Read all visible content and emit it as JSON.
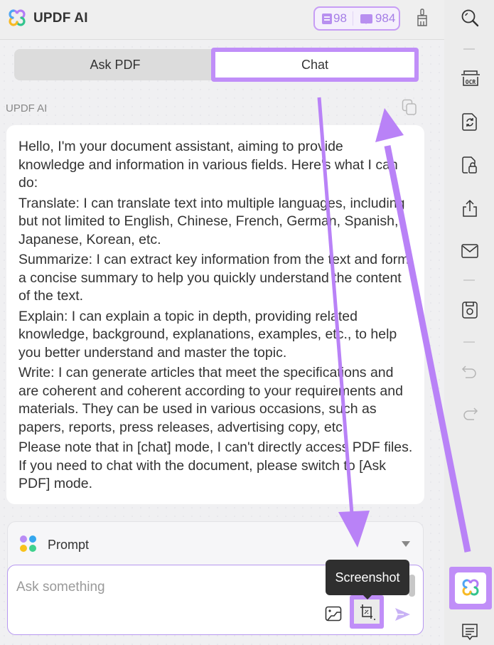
{
  "app": {
    "title": "UPDF AI",
    "logo_icon": "updf-ai-logo-icon"
  },
  "quota": {
    "pdf_count": "98",
    "chat_count": "984",
    "pdf_icon": "document-quota-icon",
    "chat_icon": "chat-quota-icon"
  },
  "header_actions": {
    "clear_icon": "brush-icon"
  },
  "tabs": [
    {
      "label": "Ask PDF",
      "active": false
    },
    {
      "label": "Chat",
      "active": true
    }
  ],
  "message": {
    "sender": "UPDF AI",
    "copy_icon": "copy-icon",
    "paragraphs": [
      "Hello, I'm your document assistant, aiming to provide knowledge and information in various fields. Here's what I can do:",
      "Translate: I can translate text into multiple languages, including but not limited to English, Chinese, French, German, Spanish, Japanese, Korean, etc.",
      "Summarize: I can extract key information from the text and form a concise summary to help you quickly understand the content of the text.",
      "Explain: I can explain a topic in depth, providing related knowledge, background, explanations, examples, etc., to help you better understand and master the topic.",
      "Write: I can generate articles that meet the specifications and are coherent and coherent according to your requirements and materials. They can be used in various occasions, such as papers, reports, press releases, advertising copy, etc.",
      "Please note that in [chat] mode, I can't directly access PDF files. If you need to chat with the document, please switch to [Ask PDF] mode."
    ]
  },
  "prompt": {
    "label": "Prompt",
    "dot_colors": [
      "#b98cf5",
      "#35a7ee",
      "#f8c21b",
      "#3fd18d"
    ]
  },
  "input": {
    "placeholder": "Ask something",
    "value": ""
  },
  "input_actions": {
    "image_icon": "image-upload-icon",
    "screenshot_icon": "screenshot-crop-icon",
    "send_icon": "send-icon",
    "tooltip": "Screenshot"
  },
  "right_toolbar": {
    "items": [
      "search",
      "ocr",
      "convert",
      "protect",
      "share",
      "email",
      "save",
      "undo",
      "redo",
      "updf-ai",
      "comment"
    ]
  },
  "colors": {
    "accent": "#c08ef8",
    "quota_text": "#a57ee6",
    "tooltip_bg": "#2f2f2f"
  }
}
